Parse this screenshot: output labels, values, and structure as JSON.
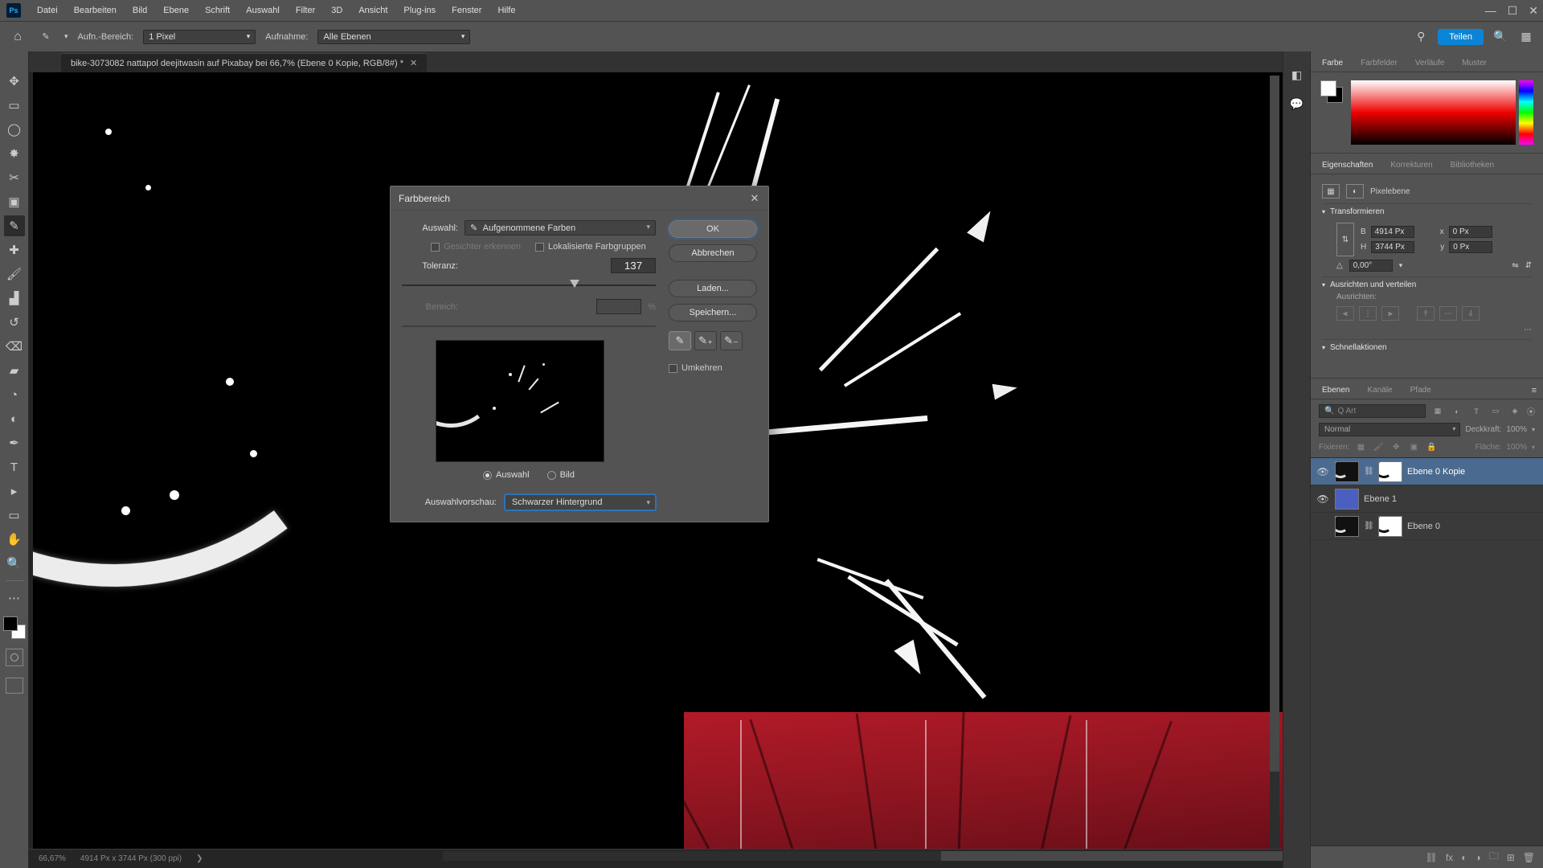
{
  "menu": {
    "items": [
      "Datei",
      "Bearbeiten",
      "Bild",
      "Ebene",
      "Schrift",
      "Auswahl",
      "Filter",
      "3D",
      "Ansicht",
      "Plug-ins",
      "Fenster",
      "Hilfe"
    ]
  },
  "options_bar": {
    "sample_label": "Aufn.-Bereich:",
    "sample_value": "1 Pixel",
    "sample2_label": "Aufnahme:",
    "sample2_value": "Alle Ebenen",
    "share_label": "Teilen"
  },
  "document_tab": {
    "title": "bike-3073082 nattapol deejitwasin auf Pixabay bei 66,7% (Ebene 0 Kopie, RGB/8#) *"
  },
  "status_bar": {
    "zoom": "66,67%",
    "doc_info": "4914 Px x 3744 Px (300 ppi)",
    "arrow": "❯"
  },
  "color_panel": {
    "tabs": [
      "Farbe",
      "Farbfelder",
      "Verläufe",
      "Muster"
    ]
  },
  "properties_panel": {
    "tabs": [
      "Eigenschaften",
      "Korrekturen",
      "Bibliotheken"
    ],
    "type_label": "Pixelebene",
    "transform_header": "Transformieren",
    "w_label": "B",
    "w_value": "4914 Px",
    "x_label": "x",
    "x_value": "0 Px",
    "h_label": "H",
    "h_value": "3744 Px",
    "y_label": "y",
    "y_value": "0 Px",
    "angle_label": "△",
    "angle_value": "0,00°",
    "align_header": "Ausrichten und verteilen",
    "align_label": "Ausrichten:",
    "quick_header": "Schnellaktionen"
  },
  "layers_panel": {
    "tabs": [
      "Ebenen",
      "Kanäle",
      "Pfade"
    ],
    "search_placeholder": "Q Art",
    "blend_mode": "Normal",
    "opacity_label": "Deckkraft:",
    "opacity_value": "100%",
    "lock_label": "Fixieren:",
    "fill_label": "Fläche:",
    "fill_value": "100%",
    "layers": [
      {
        "name": "Ebene 0 Kopie",
        "visible": true,
        "has_mask": true,
        "thumb": "bike",
        "selected": true
      },
      {
        "name": "Ebene 1",
        "visible": true,
        "has_mask": false,
        "thumb": "solid",
        "selected": false
      },
      {
        "name": "Ebene 0",
        "visible": false,
        "has_mask": true,
        "thumb": "bike",
        "selected": false
      }
    ]
  },
  "dialog": {
    "title": "Farbbereich",
    "select_label": "Auswahl:",
    "select_value": "Aufgenommene Farben",
    "faces_label": "Gesichter erkennen",
    "local_label": "Lokalisierte Farbgruppen",
    "fuzziness_label": "Toleranz:",
    "fuzziness_value": "137",
    "range_label": "Bereich:",
    "range_unit": "%",
    "radio_selection": "Auswahl",
    "radio_image": "Bild",
    "preview_label": "Auswahlvorschau:",
    "preview_value": "Schwarzer Hintergrund",
    "ok": "OK",
    "cancel": "Abbrechen",
    "load": "Laden...",
    "save": "Speichern...",
    "invert": "Umkehren"
  }
}
